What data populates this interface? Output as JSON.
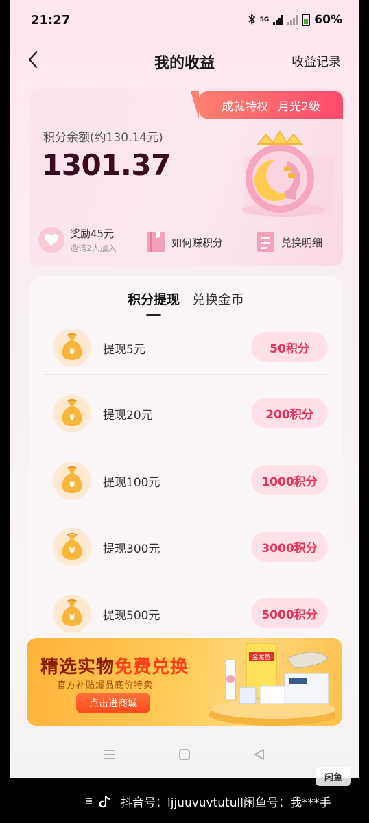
{
  "status_bar": {
    "time": "21:27",
    "battery": "60%",
    "network": "5G"
  },
  "nav": {
    "title": "我的收益",
    "record_link": "收益记录"
  },
  "card": {
    "badge_privilege": "成就特权",
    "badge_level": "月光2级",
    "balance_label": "积分余额(约130.14元)",
    "balance_value": "1301.37",
    "actions": [
      {
        "label": "奖励45元",
        "sub": "邀请2人加入"
      },
      {
        "label": "如何赚积分"
      },
      {
        "label": "兑换明细"
      }
    ]
  },
  "tabs": [
    {
      "label": "积分提现",
      "active": true
    },
    {
      "label": "兑换金币",
      "active": false
    }
  ],
  "withdraw_items": [
    {
      "label": "提现5元",
      "points": "50积分"
    },
    {
      "label": "提现20元",
      "points": "200积分"
    },
    {
      "label": "提现100元",
      "points": "1000积分"
    },
    {
      "label": "提现300元",
      "points": "3000积分"
    },
    {
      "label": "提现500元",
      "points": "5000积分"
    }
  ],
  "banner": {
    "title_part1": "精选实物",
    "title_part2": "免费兑换",
    "subtitle": "官方补贴爆品底价特卖",
    "button": "点击进商城",
    "product_brand": "金龙鱼"
  },
  "footer": {
    "text": "抖音号：ljjuuvuvtutull闲鱼号：我***手",
    "logo": "闲鱼"
  },
  "colors": {
    "accent": "#e8325a",
    "badge": "#ff4b6e",
    "balance": "#3a0a1e"
  },
  "icons": [
    "back-arrow-icon",
    "heart-icon",
    "book-icon",
    "receipt-icon",
    "money-bag-icon",
    "menu-icon",
    "home-icon",
    "back-triangle-icon",
    "tiktok-icon"
  ]
}
